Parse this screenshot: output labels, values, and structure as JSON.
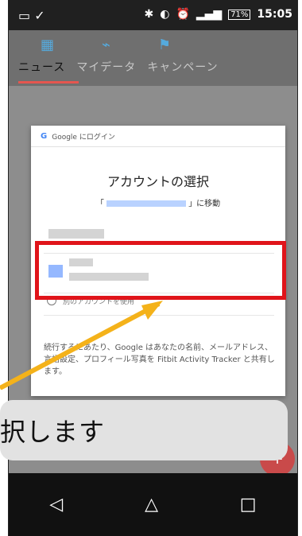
{
  "status_bar": {
    "battery": "71%",
    "time": "15:05"
  },
  "app_bar": {
    "tabs": [
      "ニュース",
      "マイデータ",
      "キャンペーン"
    ],
    "active_tab_index": 0
  },
  "dialog": {
    "header": "Google にログイン",
    "title": "アカウントの選択",
    "redirect_prefix": "「",
    "redirect_suffix": "」に移動",
    "use_another_account": "別のアカウントを使用",
    "description": "続行するにあたり、Google はあなたの名前、メールアドレス、言語設定、プロフィール写真を Fitbit Activity Tracker と共有します。"
  },
  "callout": {
    "text": "択します"
  },
  "fab": {
    "icon": "plus-icon",
    "label": "+"
  },
  "navbar": {
    "back_icon": "◁",
    "home_icon": "△",
    "recent_icon": "□"
  },
  "colors": {
    "highlight": "#e0141a",
    "arrow": "#f4b21a",
    "fab": "#c94a4a"
  }
}
